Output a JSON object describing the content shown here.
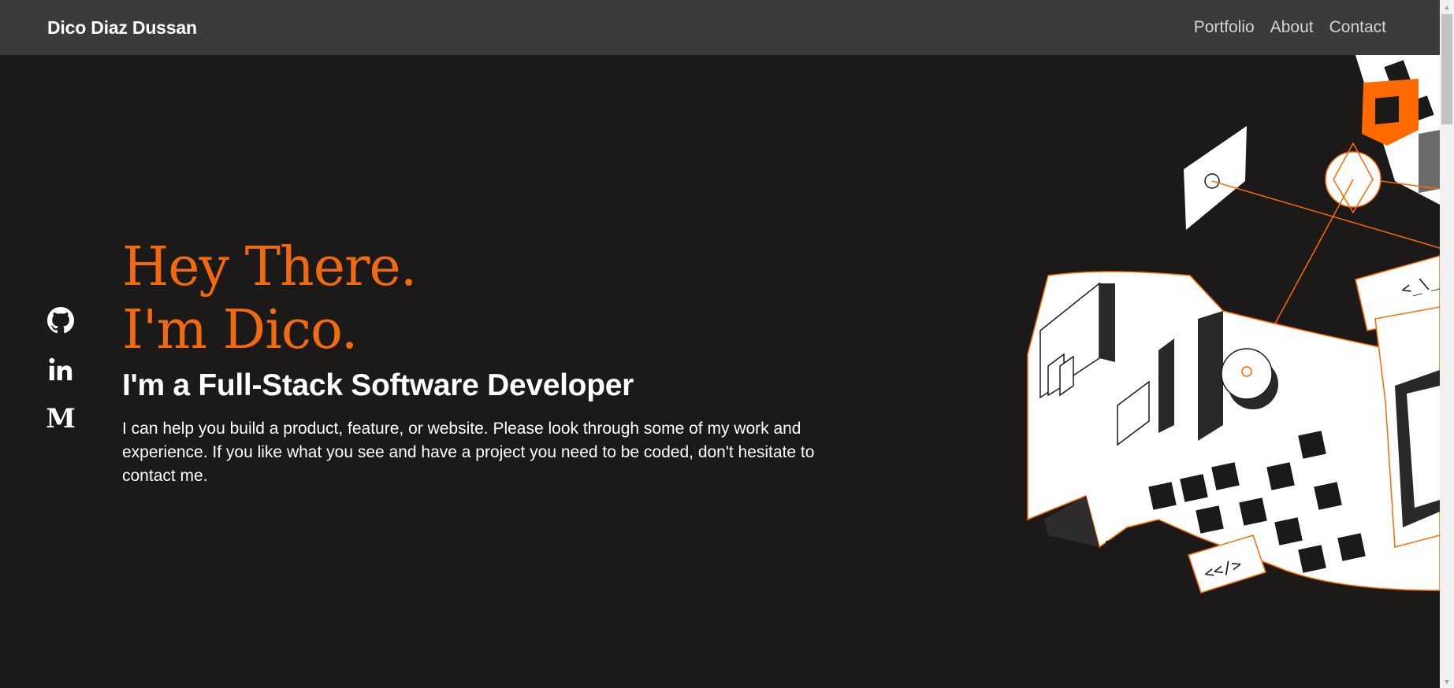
{
  "nav": {
    "brand": "Dico Diaz Dussan",
    "links": [
      "Portfolio",
      "About",
      "Contact"
    ]
  },
  "social": {
    "icons": [
      "github-icon",
      "linkedin-icon",
      "medium-icon"
    ],
    "medium_letter": "M"
  },
  "hero": {
    "line1": "Hey There.",
    "line2": "I'm Dico.",
    "tagline": "I'm a Full-Stack Software Developer",
    "intro": "I can help you build a product, feature, or website. Please look through some of my work and experience. If you like what you see and have a project you need to be coded, don't hesitate to contact me."
  },
  "illustration": {
    "code_tag_1": "<_\\_",
    "code_tag_2": "<</>"
  },
  "colors": {
    "accent": "#f26a0f",
    "background": "#1b1a19",
    "navbar": "#3c3b3a",
    "text": "#ffffff"
  }
}
